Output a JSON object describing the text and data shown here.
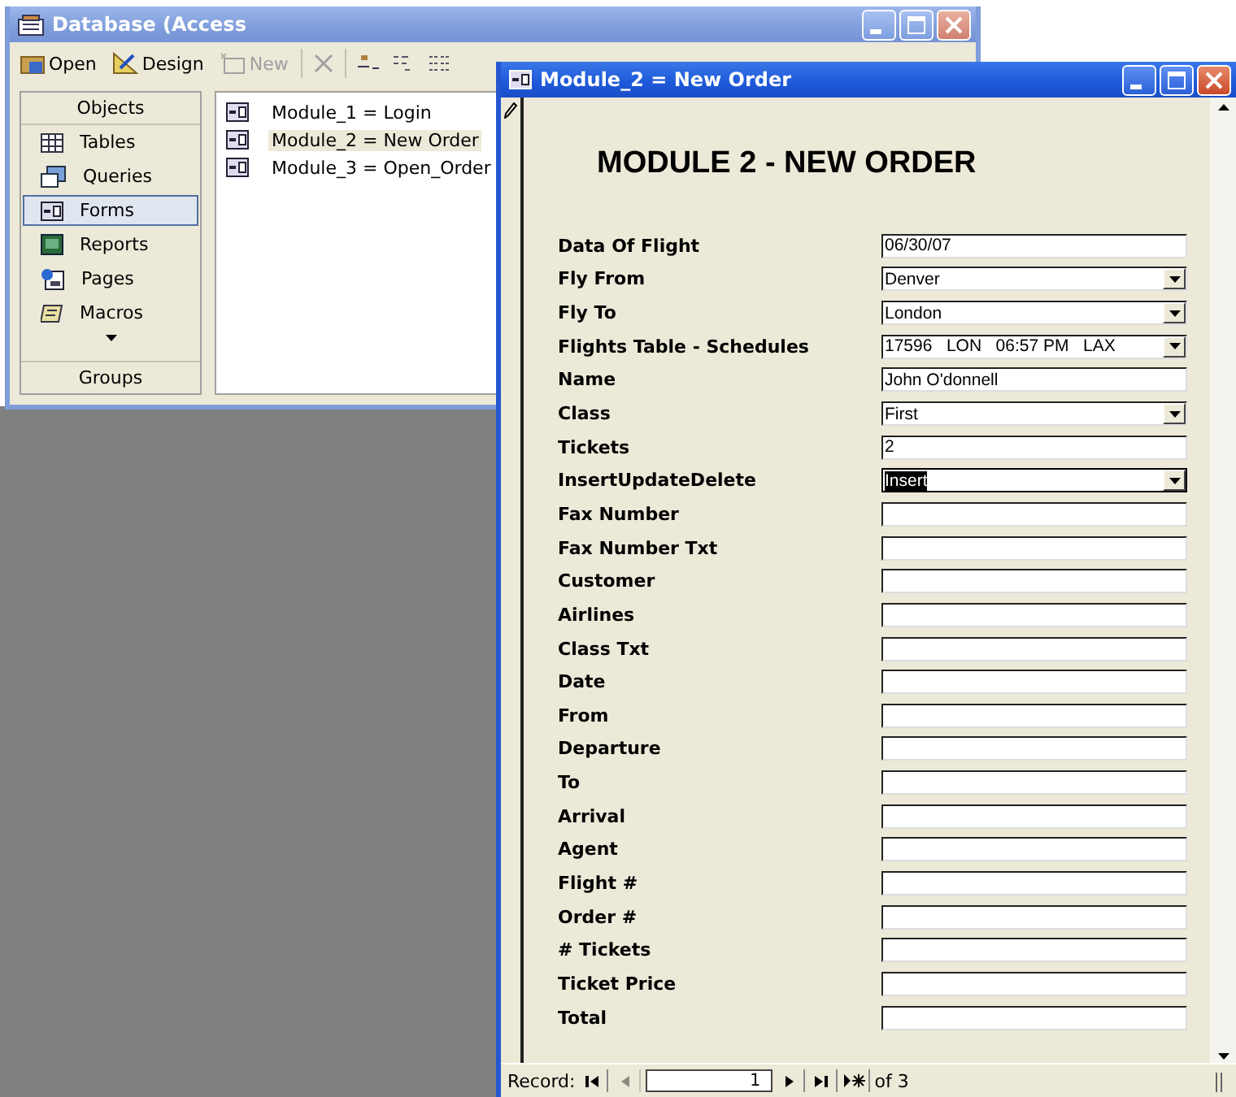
{
  "database_window": {
    "title": "Database (Access",
    "toolbar": [
      {
        "kind": "open",
        "label": "Open",
        "disabled": false
      },
      {
        "kind": "design",
        "label": "Design",
        "disabled": false
      },
      {
        "kind": "new",
        "label": "New",
        "disabled": true
      }
    ],
    "objects_header": "Objects",
    "objects": [
      {
        "kind": "tables",
        "label": "Tables",
        "selected": false
      },
      {
        "kind": "queries",
        "label": "Queries",
        "selected": false
      },
      {
        "kind": "forms",
        "label": "Forms",
        "selected": true
      },
      {
        "kind": "reports",
        "label": "Reports",
        "selected": false
      },
      {
        "kind": "pages",
        "label": "Pages",
        "selected": false
      },
      {
        "kind": "macros",
        "label": "Macros",
        "selected": false
      }
    ],
    "groups_label": "Groups",
    "forms": [
      {
        "name": "Module_1 = Login",
        "selected": false
      },
      {
        "name": "Module_2 = New Order",
        "selected": true
      },
      {
        "name": "Module_3 = Open_Order",
        "selected": false
      }
    ]
  },
  "form_window": {
    "title": "Module_2 = New Order",
    "heading": "MODULE 2 - NEW ORDER",
    "fields": [
      {
        "label": "Data Of Flight",
        "kind": "text",
        "value": "06/30/07",
        "selected": false
      },
      {
        "label": "Fly From",
        "kind": "combo",
        "value": "Denver",
        "selected": false
      },
      {
        "label": "Fly To",
        "kind": "combo",
        "value": "London",
        "selected": false
      },
      {
        "label": "Flights Table - Schedules",
        "kind": "combo",
        "value": "17596   LON   06:57 PM   LAX",
        "selected": false
      },
      {
        "label": "Name",
        "kind": "text",
        "value": "John O'donnell",
        "selected": false
      },
      {
        "label": "Class",
        "kind": "combo",
        "value": "First",
        "selected": false
      },
      {
        "label": "Tickets",
        "kind": "text",
        "value": "2",
        "selected": false
      },
      {
        "label": "InsertUpdateDelete",
        "kind": "combo",
        "value": "Insert",
        "selected": true
      },
      {
        "label": "Fax Number",
        "kind": "text",
        "selected": false
      },
      {
        "label": "Fax Number Txt",
        "kind": "text",
        "selected": false
      },
      {
        "label": "Customer",
        "kind": "text",
        "selected": false
      },
      {
        "label": "Airlines",
        "kind": "text",
        "selected": false
      },
      {
        "label": "Class Txt",
        "kind": "text",
        "selected": false
      },
      {
        "label": "Date",
        "kind": "text",
        "selected": false
      },
      {
        "label": "From",
        "kind": "text",
        "selected": false
      },
      {
        "label": "Departure",
        "kind": "text",
        "selected": false
      },
      {
        "label": "To",
        "kind": "text",
        "selected": false
      },
      {
        "label": "Arrival",
        "kind": "text",
        "selected": false
      },
      {
        "label": "Agent",
        "kind": "text",
        "selected": false
      },
      {
        "label": "Flight #",
        "kind": "text",
        "selected": false
      },
      {
        "label": "Order #",
        "kind": "text",
        "selected": false
      },
      {
        "label": "# Tickets",
        "kind": "text",
        "selected": false
      },
      {
        "label": "Ticket Price",
        "kind": "text",
        "selected": false
      },
      {
        "label": "Total",
        "kind": "text",
        "selected": false
      }
    ],
    "navigation": {
      "label": "Record:",
      "current": "1",
      "total": "of 3"
    }
  }
}
